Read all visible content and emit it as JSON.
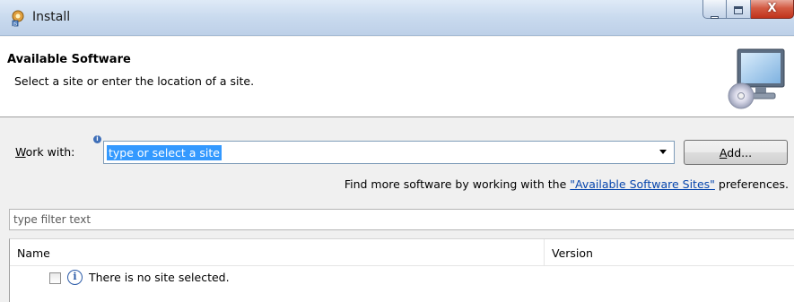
{
  "window": {
    "title": "Install",
    "controls": {
      "minimize": "—",
      "maximize": "□",
      "close": "X"
    }
  },
  "header": {
    "title": "Available Software",
    "description": "Select a site or enter the location of a site."
  },
  "work_with": {
    "label_underlined": "W",
    "label_rest": "ork with:",
    "value": "type or select a site",
    "add_underlined": "A",
    "add_rest": "dd..."
  },
  "find_more": {
    "prefix": "Find more software by working with the ",
    "link": "\"Available Software Sites\"",
    "suffix": " preferences."
  },
  "filter": {
    "placeholder": "type filter text"
  },
  "table": {
    "columns": [
      "Name",
      "Version"
    ],
    "rows": [
      {
        "text": "There is no site selected.",
        "checked": false
      }
    ]
  },
  "colors": {
    "selection": "#3399ff",
    "link": "#0645ad",
    "info": "#2b5ba8"
  }
}
